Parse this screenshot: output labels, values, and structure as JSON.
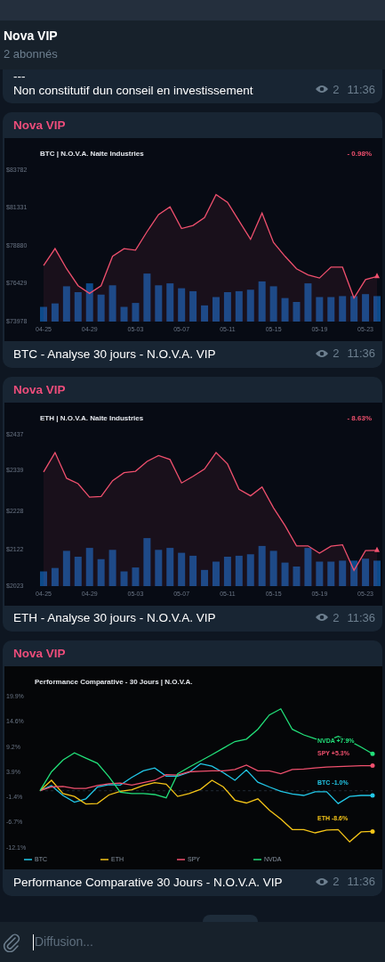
{
  "header": {
    "title": "Nova VIP",
    "subtitle": "2 abonnés"
  },
  "messages": [
    {
      "kind": "text",
      "lines": [
        "---",
        "Non constitutif dun conseil en investissement"
      ],
      "views": "2",
      "time": "11:36"
    },
    {
      "kind": "price",
      "author": "Nova VIP",
      "change": "- 0.98%",
      "caption": "BTC - Analyse 30 jours - N.O.V.A. VIP",
      "views": "2",
      "time": "11:36",
      "chart_data": {
        "type": "area",
        "title": "BTC | N.O.V.A. Naite Industries",
        "categories": [
          "04-25",
          null,
          null,
          null,
          "04-29",
          null,
          null,
          null,
          "05-03",
          null,
          null,
          null,
          "05-07",
          null,
          null,
          null,
          "05-11",
          null,
          null,
          null,
          "05-15",
          null,
          null,
          null,
          "05-19",
          null,
          null,
          null,
          "05-23",
          null
        ],
        "series": [
          {
            "color": "#f0506e",
            "values": [
              77600,
              78700,
              77400,
              76300,
              75800,
              76300,
              78200,
              78700,
              78600,
              79800,
              80900,
              81400,
              80000,
              80200,
              80700,
              82200,
              81700,
              80500,
              79300,
              81000,
              79100,
              78200,
              77400,
              77000,
              76800,
              77500,
              77500,
              75500,
              76700,
              76900
            ]
          }
        ],
        "ylim": [
          73978,
          83782
        ],
        "yticks": [
          {
            "value": 83782,
            "label": "$83782"
          },
          {
            "value": 81331,
            "label": "$81331"
          },
          {
            "value": 78880,
            "label": "$78880"
          },
          {
            "value": 76429,
            "label": "$76429"
          },
          {
            "value": 73978,
            "label": "$73978"
          }
        ]
      }
    },
    {
      "kind": "price",
      "author": "Nova VIP",
      "change": "- 8.63%",
      "caption": "ETH - Analyse 30 jours - N.O.V.A. VIP",
      "views": "2",
      "time": "11:36",
      "chart_data": {
        "type": "area",
        "title": "ETH | N.O.V.A. Naite Industries",
        "categories": [
          "04-25",
          null,
          null,
          null,
          "04-29",
          null,
          null,
          null,
          "05-03",
          null,
          null,
          null,
          "05-07",
          null,
          null,
          null,
          "05-11",
          null,
          null,
          null,
          "05-15",
          null,
          null,
          null,
          "05-19",
          null,
          null,
          null,
          "05-23",
          null
        ],
        "series": [
          {
            "color": "#f0506e",
            "values": [
              2335,
              2388,
              2318,
              2303,
              2266,
              2268,
              2311,
              2333,
              2337,
              2364,
              2380,
              2369,
              2305,
              2323,
              2343,
              2388,
              2357,
              2288,
              2270,
              2294,
              2237,
              2188,
              2133,
              2133,
              2113,
              2132,
              2136,
              2066,
              2120,
              2121
            ]
          }
        ],
        "ylim": [
          2023,
          2437
        ],
        "yticks": [
          {
            "value": 2437,
            "label": "$2437"
          },
          {
            "value": 2339,
            "label": "$2339"
          },
          {
            "value": 2228,
            "label": "$2228"
          },
          {
            "value": 2122,
            "label": "$2122"
          },
          {
            "value": 2023,
            "label": "$2023"
          }
        ]
      }
    },
    {
      "kind": "compare",
      "author": "Nova VIP",
      "caption": "Performance Comparative 30 Jours - N.O.V.A. VIP",
      "views": "2",
      "time": "11:36",
      "chart_data": {
        "type": "line",
        "title": "Performance Comparative - 30 Jours | N.O.V.A.",
        "series": [
          {
            "name": "BTC",
            "color": "#22c8e8",
            "values": [
              0,
              1.1,
              -1.0,
              -2.4,
              -1.7,
              0.8,
              1.3,
              1.2,
              2.8,
              4.2,
              4.8,
              3.1,
              3.1,
              3.9,
              5.7,
              5.2,
              3.8,
              2.2,
              4.4,
              1.8,
              0.8,
              -0.1,
              -0.7,
              -1.0,
              -0.2,
              -0.2,
              -2.7,
              -1.2,
              -1.0,
              -1.0
            ]
          },
          {
            "name": "ETH",
            "color": "#f5c518",
            "values": [
              0,
              2.2,
              -0.6,
              -1.2,
              -2.8,
              -2.7,
              -0.9,
              -0.1,
              0.2,
              1.1,
              1.7,
              1.4,
              -1.2,
              -0.6,
              0.3,
              2.2,
              0.8,
              -2.0,
              -2.6,
              -1.7,
              -4.1,
              -6.0,
              -8.2,
              -8.2,
              -8.9,
              -8.3,
              -8.2,
              -10.8,
              -8.7,
              -8.6
            ]
          },
          {
            "name": "SPY",
            "color": "#f0506e",
            "values": [
              0,
              0.8,
              0.9,
              0.5,
              0.5,
              1.1,
              1.5,
              1.6,
              1.2,
              1.7,
              2.2,
              3.4,
              3.3,
              4.0,
              4.1,
              4.2,
              4.2,
              4.5,
              5.4,
              4.2,
              4.2,
              3.6,
              4.5,
              4.6,
              4.8,
              5.0,
              5.1,
              5.2,
              5.3,
              5.3
            ]
          },
          {
            "name": "NVDA",
            "color": "#22e07a",
            "values": [
              0,
              4,
              6.5,
              8,
              6.9,
              5.8,
              3,
              -0.3,
              -0.6,
              -0.6,
              -0.8,
              -1.5,
              3.6,
              5,
              6.3,
              7.6,
              9,
              10.4,
              10.9,
              13,
              16,
              17.3,
              13,
              11.8,
              11,
              10.5,
              11.5,
              10.5,
              9.2,
              7.8
            ]
          }
        ],
        "ylim": [
          -12.1,
          19.9
        ],
        "yticks": [
          {
            "value": 19.9,
            "label": "19.9%"
          },
          {
            "value": 14.6,
            "label": "14.6%"
          },
          {
            "value": 9.2,
            "label": "9.2%"
          },
          {
            "value": 3.9,
            "label": "3.9%"
          },
          {
            "value": -1.4,
            "label": "-1.4%"
          },
          {
            "value": -6.7,
            "label": "-6.7%"
          },
          {
            "value": -12.1,
            "label": "-12.1%"
          }
        ],
        "ref_lines": [
          {
            "axis": "y",
            "value": 0
          }
        ],
        "legend": true,
        "annotations": [
          "NVDA +7.9%",
          "SPY +5.3%",
          "BTC -1.0%",
          "ETH -8.6%"
        ]
      }
    }
  ],
  "composer": {
    "placeholder": "Diffusion..."
  }
}
